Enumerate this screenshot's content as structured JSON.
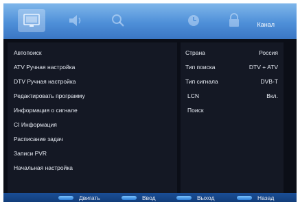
{
  "header": {
    "tabs": [
      {
        "icon": "picture-icon"
      },
      {
        "icon": "sound-icon"
      },
      {
        "icon": "search-icon"
      },
      {
        "icon": "clock-icon"
      },
      {
        "icon": "lock-icon"
      }
    ],
    "active_tab_title": "Канал"
  },
  "menu": {
    "items": [
      "Автопоиск",
      "ATV Ручная настройка",
      "DTV Ручная настройка",
      "Редактировать программу",
      "Информация о сигнале",
      "CI Информация",
      "Расписание задач",
      "Записи PVR",
      "Начальная настройка"
    ]
  },
  "settings": {
    "country": {
      "label": "Страна",
      "value": "Россия"
    },
    "search_type": {
      "label": "Тип поиска",
      "value": "DTV + ATV"
    },
    "signal_type": {
      "label": "Тип сигнала",
      "value": "DVB-T"
    },
    "lcn": {
      "label": "LCN",
      "value": "Вкл."
    },
    "search": {
      "label": "Поиск"
    }
  },
  "footer": {
    "move": "Двигать",
    "enter": "Ввод",
    "exit": "Выход",
    "back": "Назад"
  }
}
